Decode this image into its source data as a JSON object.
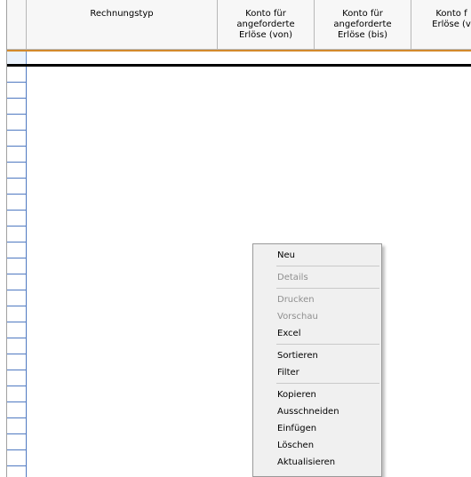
{
  "columns": [
    {
      "label": "Rechnungstyp"
    },
    {
      "label": "Konto für\nangeforderte\nErlöse (von)"
    },
    {
      "label": "Konto für\nangeforderte\nErlöse (bis)"
    },
    {
      "label": "Konto f\nErlöse (v"
    }
  ],
  "context_menu": {
    "new": "Neu",
    "details": "Details",
    "print": "Drucken",
    "preview": "Vorschau",
    "excel": "Excel",
    "sort": "Sortieren",
    "filter": "Filter",
    "copy": "Kopieren",
    "cut": "Ausschneiden",
    "paste": "Einfügen",
    "delete": "Löschen",
    "refresh": "Aktualisieren"
  }
}
